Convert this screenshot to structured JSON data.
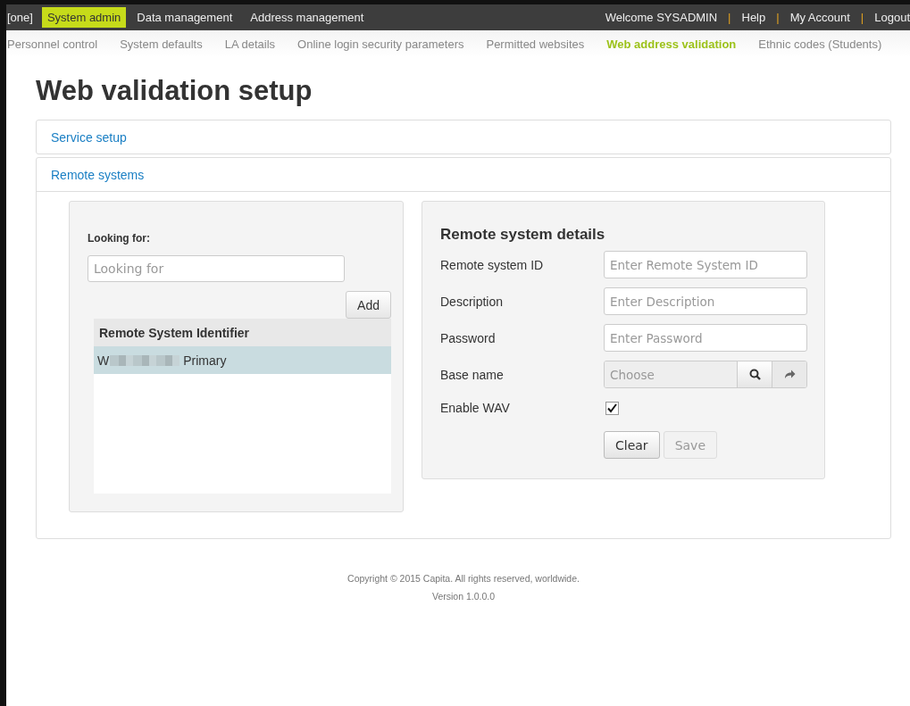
{
  "top_nav": {
    "items": [
      {
        "label": "[one]",
        "selected": false
      },
      {
        "label": "System admin",
        "selected": true
      },
      {
        "label": "Data management",
        "selected": false
      },
      {
        "label": "Address management",
        "selected": false
      }
    ],
    "user_links": [
      {
        "kind": "text",
        "label": "Welcome SYSADMIN"
      },
      {
        "kind": "separator",
        "label": "|"
      },
      {
        "kind": "link",
        "label": "Help"
      },
      {
        "kind": "separator",
        "label": "|"
      },
      {
        "kind": "link",
        "label": "My Account"
      },
      {
        "kind": "separator",
        "label": "|"
      },
      {
        "kind": "link",
        "label": "Logout"
      }
    ]
  },
  "sub_nav": [
    {
      "label": "Personnel control",
      "selected": false
    },
    {
      "label": "System defaults",
      "selected": false
    },
    {
      "label": "LA details",
      "selected": false
    },
    {
      "label": "Online login security parameters",
      "selected": false
    },
    {
      "label": "Permitted websites",
      "selected": false
    },
    {
      "label": "Web address validation",
      "selected": true
    },
    {
      "label": "Ethnic codes (Students)",
      "selected": false
    }
  ],
  "page_title": "Web validation setup",
  "panels": [
    {
      "title": "Service setup",
      "expanded": false
    },
    {
      "title": "Remote systems",
      "expanded": true
    }
  ],
  "search_card": {
    "label": "Looking for:",
    "placeholder": "Looking for",
    "add_button": "Add",
    "table": {
      "columns": [
        "Remote System Identifier"
      ],
      "rows": [
        {
          "text_start": "W",
          "text_end": "Primary",
          "selected": true
        }
      ]
    }
  },
  "details_card": {
    "title": "Remote system details",
    "fields": [
      {
        "kind": "text",
        "label": "Remote system ID",
        "placeholder": "Enter Remote System ID"
      },
      {
        "kind": "text",
        "label": "Description",
        "placeholder": "Enter Description"
      },
      {
        "kind": "text",
        "label": "Password",
        "placeholder": "Enter Password"
      },
      {
        "kind": "lookup",
        "label": "Base name",
        "placeholder": "Choose"
      },
      {
        "kind": "checkbox",
        "label": "Enable WAV",
        "checked": true
      }
    ],
    "buttons": [
      {
        "label": "Clear",
        "disabled": false
      },
      {
        "label": "Save",
        "disabled": true
      }
    ]
  },
  "footer": {
    "copyright": "Copyright © 2015 Capita. All rights reserved, worldwide.",
    "version": "Version 1.0.0.0"
  }
}
